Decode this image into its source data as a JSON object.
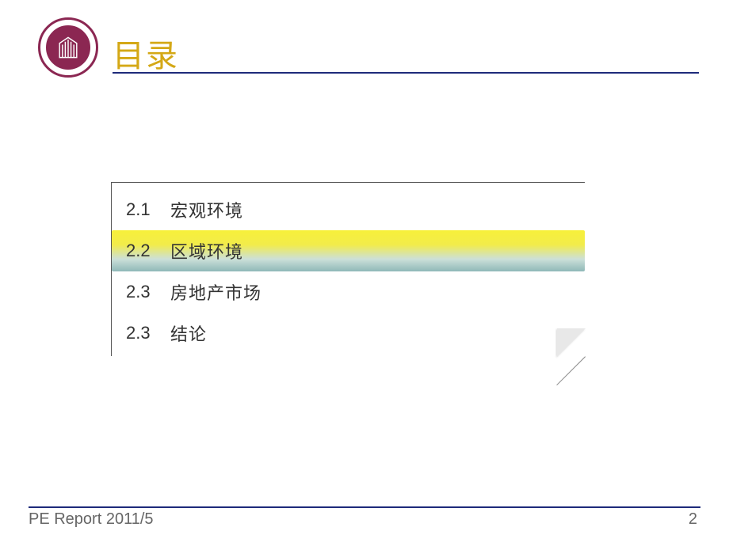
{
  "header": {
    "title": "目录"
  },
  "toc": {
    "items": [
      {
        "num": "2.1",
        "label": "宏观环境",
        "highlighted": false
      },
      {
        "num": "2.2",
        "label": "区域环境",
        "highlighted": true
      },
      {
        "num": "2.3",
        "label": "房地产市场",
        "highlighted": false
      },
      {
        "num": "2.3",
        "label": "结论",
        "highlighted": false
      }
    ]
  },
  "footer": {
    "report": "PE Report  2011/5",
    "page": "2"
  }
}
